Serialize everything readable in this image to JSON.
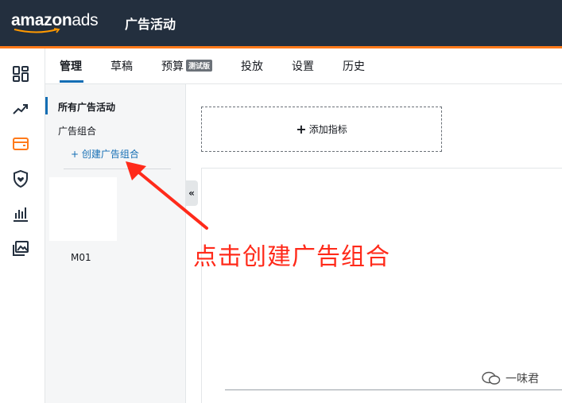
{
  "header": {
    "brand_main": "amazon",
    "brand_suffix": "ads",
    "title": "广告活动"
  },
  "rail": {
    "icons": [
      "dashboard-icon",
      "trend-icon",
      "campaign-icon",
      "shield-icon",
      "reports-icon",
      "media-icon"
    ],
    "active": "campaign-icon"
  },
  "tabs": [
    {
      "label": "管理",
      "active": true
    },
    {
      "label": "草稿"
    },
    {
      "label": "预算",
      "badge": "测试版"
    },
    {
      "label": "投放"
    },
    {
      "label": "设置"
    },
    {
      "label": "历史"
    }
  ],
  "nav": {
    "all_campaigns": "所有广告活动",
    "ad_groups": "广告组合",
    "create_ad_group": "+ 创建广告组合",
    "thumb_label": "M01",
    "collapse": "«"
  },
  "main": {
    "add_metric_plus": "+",
    "add_metric_label": "添加指标"
  },
  "annotation": {
    "text": "点击创建广告组合",
    "color": "#ff2a1a"
  },
  "watermark": {
    "text": "一味君"
  },
  "colors": {
    "topbar": "#232f3e",
    "accent": "#ff7a1a",
    "link": "#146eb4"
  }
}
